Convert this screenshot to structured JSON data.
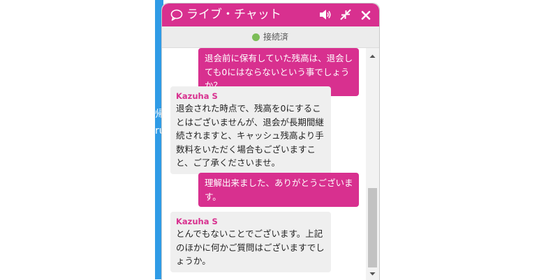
{
  "background": {
    "fragments": [
      "帰",
      "ru"
    ]
  },
  "chat": {
    "title": "ライブ・チャット",
    "icons": {
      "chat": "speech-bubble-icon",
      "sound": "speaker-icon",
      "minimize": "minimize-arrows-icon",
      "close": "close-icon"
    },
    "status": {
      "label": "接続済",
      "color": "#7cbd58"
    },
    "messages": [
      {
        "sender": "user",
        "text": "退会前に保有していた残高は、退会しても0にはならないという事でしょうか？"
      },
      {
        "sender": "agent",
        "name": "Kazuha S",
        "text": "退会された時点で、残高を0にすることはございませんが、退会が長期間継続されますと、キャッシュ残高より手数料をいただく場合もございますこと、ご了承くださいませ。"
      },
      {
        "sender": "user",
        "text": "理解出来ました、ありがとうございます。"
      },
      {
        "sender": "agent",
        "name": "Kazuha S",
        "text": "とんでもないことでございます。上記のほかに何かご質問はございますでしょうか。"
      }
    ]
  },
  "colors": {
    "accent": "#d8308f",
    "agent_bubble": "#efefef",
    "status_bar": "#ececec"
  }
}
